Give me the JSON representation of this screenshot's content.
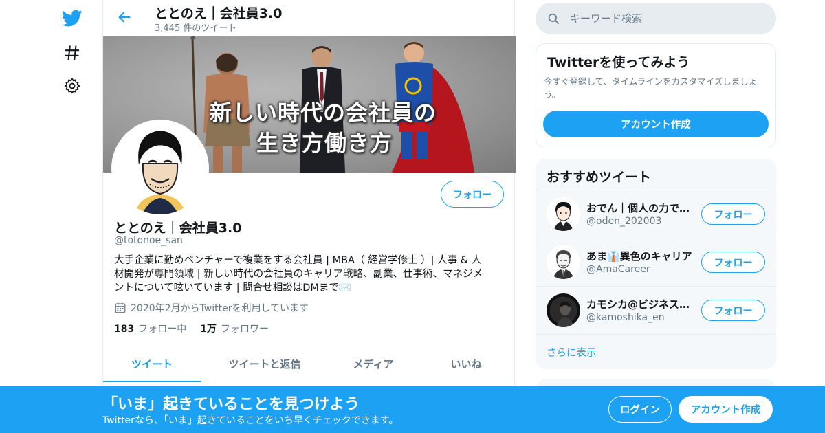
{
  "header": {
    "title": "ととのえ｜会社員3.0",
    "tweet_count": "3,445 件のツイート"
  },
  "banner": {
    "line1": "新しい時代の会社員の",
    "line2": "生き方働き方"
  },
  "profile": {
    "name": "ととのえ｜会社員3.0",
    "handle": "@totonoe_san",
    "follow_label": "フォロー",
    "bio_lines": [
      "大手企業に勤めベンチャーで複業をする会社員 | MBA（ 経営学修士 ）| 人事 & 人",
      "材開発が専門領域 | 新しい時代の会社員のキャリア戦略、副業、仕事術、マネジメ",
      "ントについて呟いています | 問合せ相談はDMまで✉️"
    ],
    "joined": "2020年2月からTwitterを利用しています",
    "following_count": "183",
    "following_label": "フォロー中",
    "followers_count": "1万",
    "followers_label": "フォロワー"
  },
  "tabs": [
    "ツイート",
    "ツイートと返信",
    "メディア",
    "いいね"
  ],
  "search": {
    "placeholder": "キーワード検索"
  },
  "try_card": {
    "title": "Twitterを使ってみよう",
    "description": "今すぐ登録して、タイムラインをカスタマイズしましょう。",
    "button": "アカウント作成"
  },
  "recommend": {
    "title": "おすすめツイート",
    "users": [
      {
        "name": "おでん｜個人の力で…",
        "handle": "@oden_202003",
        "button": "フォロー"
      },
      {
        "name": "あま👔異色のキャリア",
        "handle": "@AmaCareer",
        "button": "フォロー"
      },
      {
        "name": "カモシカ@ビジネス…",
        "handle": "@kamoshika_en",
        "button": "フォロー"
      }
    ],
    "more": "さらに表示"
  },
  "bottom_bar": {
    "headline": "「いま」起きていることを見つけよう",
    "subtext": "Twitterなら、「いま」起きていることをいち早くチェックできます。",
    "login": "ログイン",
    "signup": "アカウント作成"
  },
  "colors": {
    "accent": "#1da1f2",
    "secondary_text": "#657786",
    "border": "#e6ecf0"
  },
  "icons": [
    "twitter-bird-icon",
    "hashtag-icon",
    "gear-icon",
    "back-arrow-icon",
    "search-icon",
    "calendar-icon"
  ]
}
